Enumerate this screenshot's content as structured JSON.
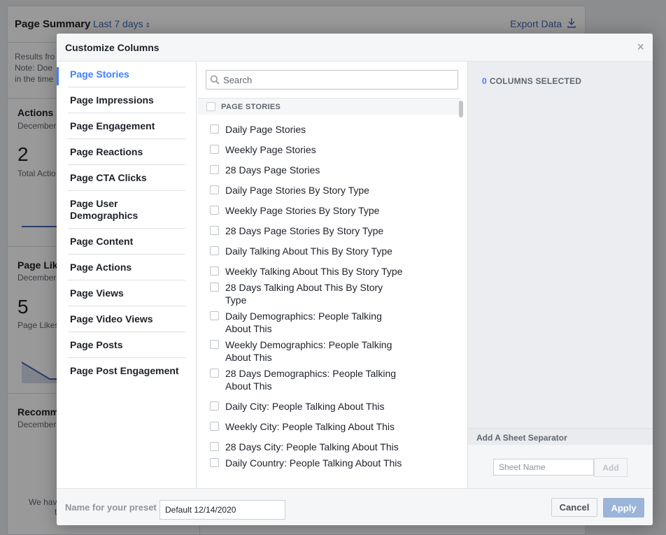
{
  "background": {
    "title": "Page Summary",
    "range": "Last 7 days",
    "export": "Export Data",
    "note_lines": [
      "Results fro",
      "Note: Doe",
      "in the time"
    ],
    "sections": [
      {
        "title": "Actions c",
        "date": "December",
        "big": "2",
        "small": "Total Actio"
      },
      {
        "title": "Page Lik",
        "date": "December",
        "big": "5",
        "small": "Page Likes"
      },
      {
        "title": "Recomm",
        "date": "December",
        "big": "",
        "small": ""
      }
    ],
    "message_lines": [
      "We hav",
      "t"
    ]
  },
  "modal": {
    "title": "Customize Columns",
    "close_glyph": "×",
    "nav": [
      {
        "label": "Page Stories",
        "active": true
      },
      {
        "label": "Page Impressions"
      },
      {
        "label": "Page Engagement"
      },
      {
        "label": "Page Reactions"
      },
      {
        "label": "Page CTA Clicks"
      },
      {
        "label": "Page User Demographics"
      },
      {
        "label": "Page Content"
      },
      {
        "label": "Page Actions"
      },
      {
        "label": "Page Views"
      },
      {
        "label": "Page Video Views"
      },
      {
        "label": "Page Posts"
      },
      {
        "label": "Page Post Engagement"
      }
    ],
    "search": {
      "placeholder": "Search",
      "value": ""
    },
    "section_header": "PAGE STORIES",
    "items": [
      "Daily Page Stories",
      "Weekly Page Stories",
      "28 Days Page Stories",
      "Daily Page Stories By Story Type",
      "Weekly Page Stories By Story Type",
      "28 Days Page Stories By Story Type",
      "Daily Talking About This By Story Type",
      "Weekly Talking About This By Story Type",
      "28 Days Talking About This By Story Type",
      "Daily Demographics: People Talking About This",
      "Weekly Demographics: People Talking About This",
      "28 Days Demographics: People Talking About This",
      "Daily City: People Talking About This",
      "Weekly City: People Talking About This",
      "28 Days City: People Talking About This",
      "Daily Country: People Talking About This"
    ],
    "selected": {
      "count": "0",
      "label": "COLUMNS SELECTED"
    },
    "separator": {
      "label": "Add A Sheet Separator",
      "placeholder": "Sheet Name",
      "add_label": "Add"
    },
    "footer": {
      "preset_label": "Name for your preset",
      "preset_value": "Default 12/14/2020",
      "cancel_label": "Cancel",
      "apply_label": "Apply"
    }
  },
  "colors": {
    "accent": "#4080ff",
    "link": "#4267b2",
    "apply_disabled": "#9cb4d8"
  }
}
